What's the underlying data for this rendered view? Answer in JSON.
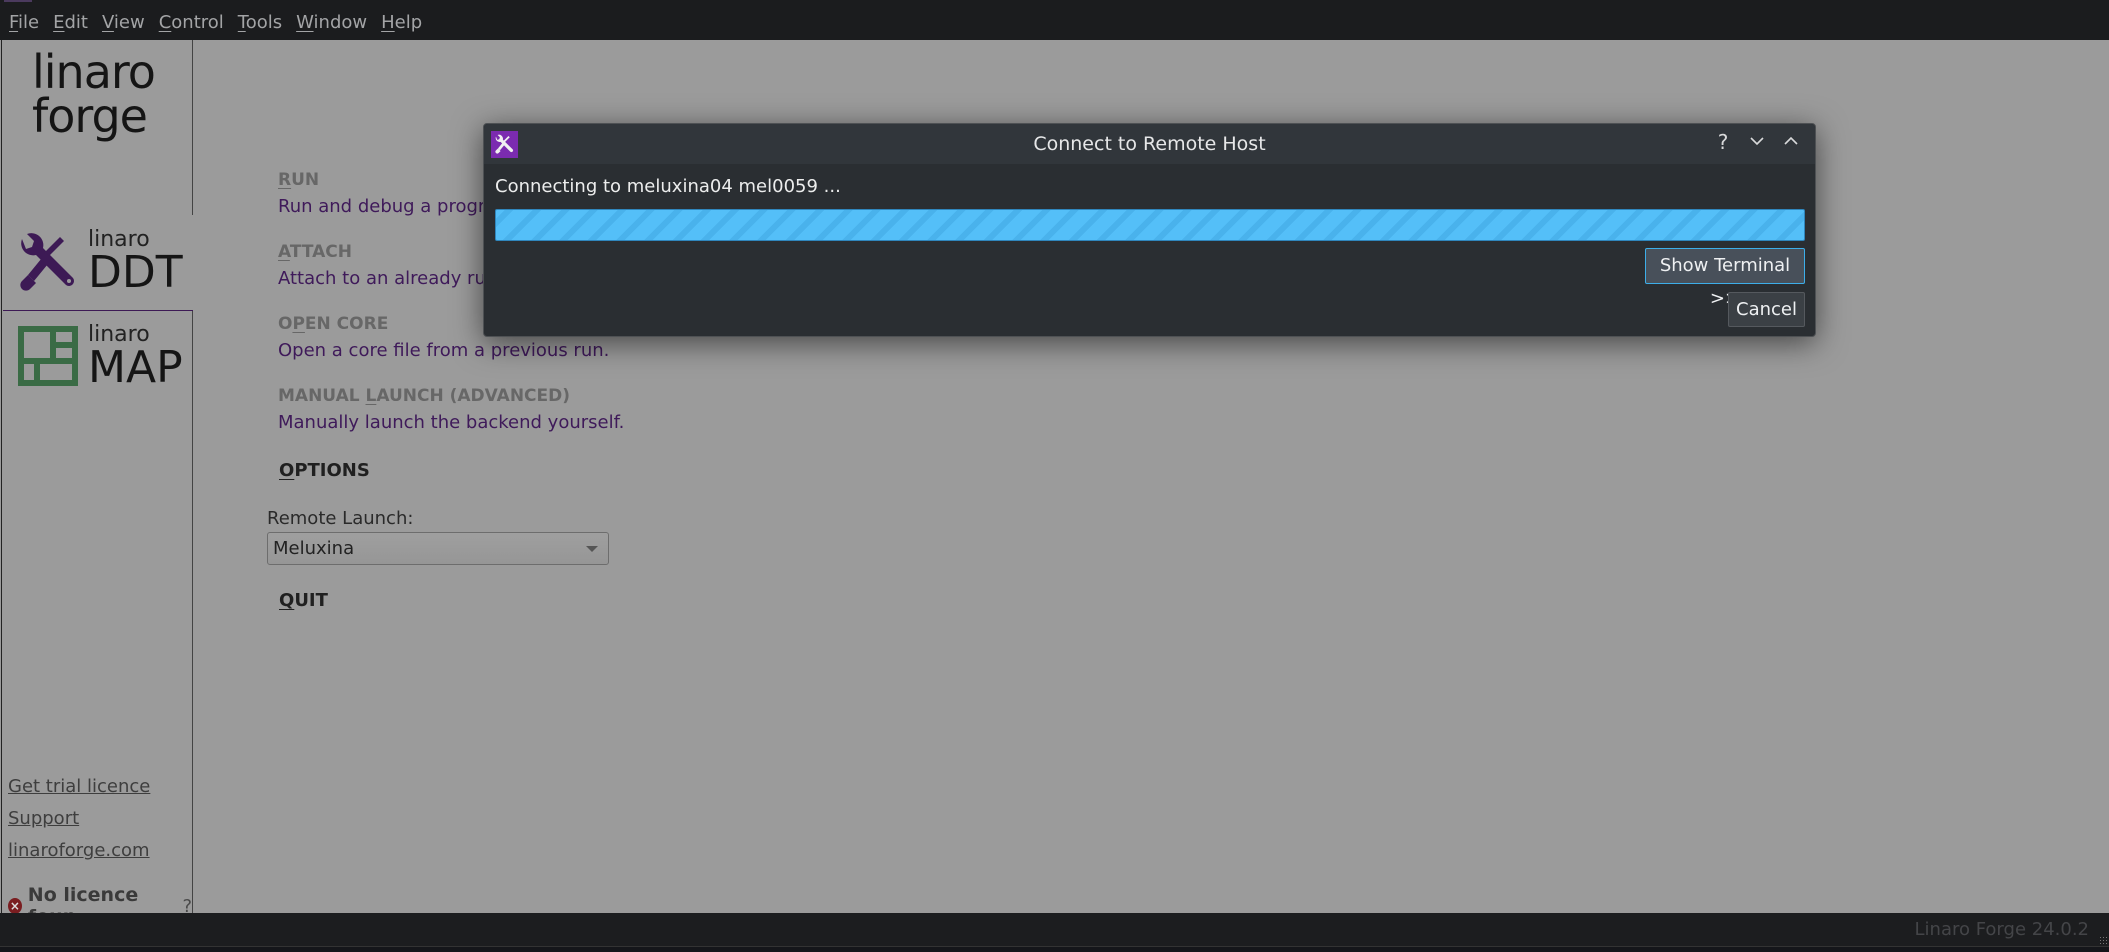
{
  "menubar": {
    "items": [
      {
        "label": "File",
        "mnemonic": "F",
        "rest": "ile"
      },
      {
        "label": "Edit",
        "mnemonic": "E",
        "rest": "dit"
      },
      {
        "label": "View",
        "mnemonic": "V",
        "rest": "iew"
      },
      {
        "label": "Control",
        "mnemonic": "C",
        "rest": "ontrol"
      },
      {
        "label": "Tools",
        "mnemonic": "T",
        "rest": "ools"
      },
      {
        "label": "Window",
        "mnemonic": "W",
        "rest": "indow"
      },
      {
        "label": "Help",
        "mnemonic": "H",
        "rest": "elp"
      }
    ]
  },
  "sidebar": {
    "logo_line1": "linaro",
    "logo_line2": "forge",
    "products": [
      {
        "small": "linaro",
        "big": "DDT",
        "icon": "wrench-screwdriver-icon",
        "color": "#3d1a55"
      },
      {
        "small": "linaro",
        "big": "MAP",
        "icon": "grid-layout-icon",
        "color": "#3a6b45"
      }
    ],
    "links": [
      "Get trial licence",
      "Support",
      "linaroforge.com"
    ],
    "licence_status": "No licence foun",
    "licence_help": "?"
  },
  "main": {
    "sections": [
      {
        "mn": "R",
        "rest": "UN",
        "desc": "Run and debug a progra"
      },
      {
        "mn": "A",
        "rest": "TTACH",
        "desc": "Attach to an already run"
      },
      {
        "pre": "O",
        "mn": "P",
        "rest": "EN CORE",
        "desc": "Open a core file from a previous run."
      },
      {
        "pre": "MANUAL ",
        "mn": "L",
        "rest": "AUNCH (ADVANCED)",
        "desc": "Manually launch the backend yourself."
      }
    ],
    "options": {
      "mn": "O",
      "rest": "PTIONS"
    },
    "remote_launch_label": "Remote Launch:",
    "remote_launch_value": "Meluxina",
    "quit": {
      "mn": "Q",
      "rest": "UIT"
    }
  },
  "statusbar": {
    "version": "Linaro Forge 24.0.2"
  },
  "dialog": {
    "title": "Connect to Remote Host",
    "help_glyph": "?",
    "minimize_glyph": "⌄",
    "maximize_glyph": "⌃",
    "status": "Connecting to meluxina04 mel0059 ...",
    "progress": "indeterminate",
    "show_terminal_label": "Show Terminal >>",
    "cancel_label": "Cancel",
    "accent": "#3daee9",
    "progress_color": "#54bff8"
  }
}
